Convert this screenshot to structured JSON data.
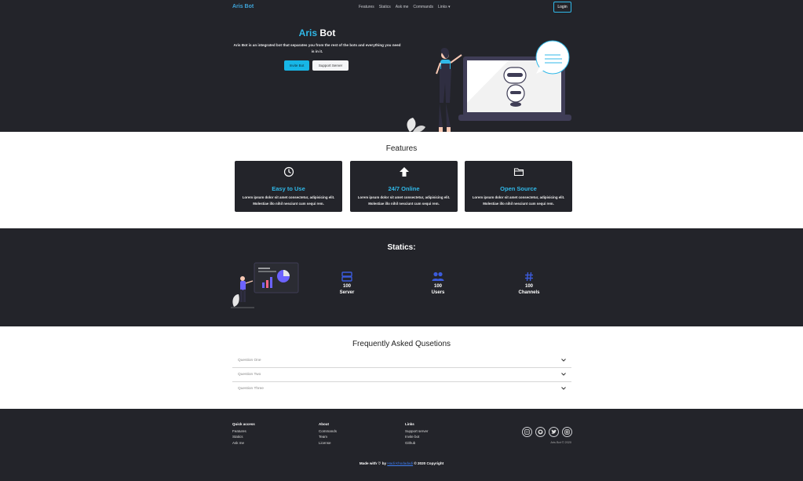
{
  "nav": {
    "brand": "Aris Bot",
    "links": [
      "Features",
      "Statics",
      "Ask me",
      "Commands",
      "Links ▾"
    ],
    "login": "Login"
  },
  "hero": {
    "title_accent": "Aris",
    "title_rest": " Bot",
    "description": "Aris Bot is an integrated bot that separates you from the rest of the bots and everything you need is in it.",
    "invite_label": "Invite Bot",
    "support_label": "Support Server"
  },
  "features": {
    "title": "Features",
    "cards": [
      {
        "title": "Easy to Use",
        "icon": "clock-icon",
        "text": "Lorem ipsum dolor sit amet consectetur, adipisicing elit. Molestiae illo nihil nesciunt cum sequi rem."
      },
      {
        "title": "24/7 Online",
        "icon": "upload-arrow-icon",
        "text": "Lorem ipsum dolor sit amet consectetur, adipisicing elit. Molestiae illo nihil nesciunt cum sequi rem."
      },
      {
        "title": "Open Source",
        "icon": "folder-icon",
        "text": "Lorem ipsum dolor sit amet consectetur, adipisicing elit. Molestiae illo nihil nesciunt cum sequi rem."
      }
    ]
  },
  "statics": {
    "title": "Statics:",
    "items": [
      {
        "value": "100",
        "label": "Server",
        "icon": "server-icon"
      },
      {
        "value": "100",
        "label": "Users",
        "icon": "users-icon"
      },
      {
        "value": "100",
        "label": "Channels",
        "icon": "hashtag-icon"
      }
    ]
  },
  "faq": {
    "title": "Frequently Asked Qusetions",
    "questions": [
      "Question One",
      "Question Two",
      "Question Three"
    ]
  },
  "footer": {
    "cols": [
      {
        "heading": "Quick access",
        "links": [
          "Features",
          "Statics",
          "Ask me"
        ]
      },
      {
        "heading": "About",
        "links": [
          "Commands",
          "Team",
          "License"
        ]
      },
      {
        "heading": "Links",
        "links": [
          "Support server",
          "Invite bot",
          "Github"
        ]
      }
    ],
    "socials": [
      "discord-icon",
      "github-icon",
      "twitter-icon",
      "instagram-icon"
    ],
    "copyright": "Aris Bot © 2020",
    "made_prefix": "Made with ♡ by ",
    "made_author": "Hadi Khodadadi",
    "made_suffix": " © 2020 Copyright"
  },
  "colors": {
    "accent": "#30b8e8",
    "dark_bg": "#23242a",
    "light_bg": "#ffffff",
    "stat_blue": "#3b5bdb"
  }
}
